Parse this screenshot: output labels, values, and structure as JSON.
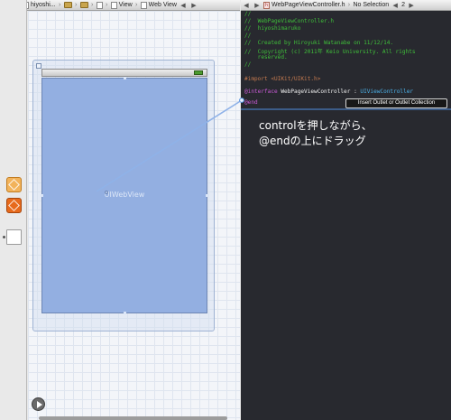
{
  "jumpbar_left": {
    "back_icon": "chevron-left-icon",
    "forward_icon": "chevron-right-icon",
    "project": "hiyoshi...",
    "scene": "View",
    "item": "Web View"
  },
  "jumpbar_right": {
    "back_icon": "chevron-left-icon",
    "forward_icon": "chevron-right-icon",
    "file": "WebPageViewController.h",
    "selection": "No Selection",
    "counter": "2"
  },
  "canvas": {
    "webview_label": "UIWebView"
  },
  "code_lines": {
    "l1": "//",
    "l2": "//  WebPageViewController.h",
    "l3": "//  hiyoshimaruko",
    "l4": "//",
    "l5": "//  Created by Hiroyuki Watanabe on 11/12/14.",
    "l6": "//  Copyright (c) 2011年 Keio University. All rights",
    "l7": "    reserved.",
    "l8": "//",
    "import_kw": "#import",
    "import_path": " <UIKit/UIKit.h>",
    "interface_kw": "@interface",
    "interface_name": " WebPageViewController : ",
    "interface_super": "UIViewController",
    "end_kw": "@end"
  },
  "tooltip": "Insert Outlet or Outlet Collection",
  "instruction": {
    "line1": "controlを押しながら、",
    "line2": "@endの上にドラッグ"
  },
  "colors": {
    "code_bg": "#28292f",
    "comment": "#3fbf3a",
    "keyword": "#c95ad6",
    "class": "#4bb1e8",
    "webview": "#93afe1",
    "connection": "#8fb2e8"
  }
}
